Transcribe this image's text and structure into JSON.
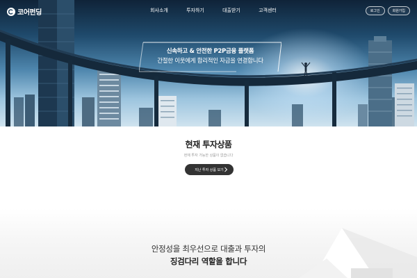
{
  "header": {
    "logo_text": "코어펀딩",
    "nav": [
      "회사소개",
      "투자하기",
      "대출받기",
      "고객센터"
    ],
    "login_label": "로그인",
    "signup_label": "회원가입"
  },
  "hero": {
    "headline_line1": "신속하고 & 안전한 P2P금융 플랫폼",
    "headline_line2": "간절한 이웃에게 합리적인 자금을 연결합니다"
  },
  "products": {
    "title": "현재 투자상품",
    "subtitle": "현재 투자 가능한 상품이 없습니다",
    "past_button_label": "지난 투자 상품 보기"
  },
  "bottom": {
    "line1": "안정성을 최우선으로 대출과 투자의",
    "line2": "징검다리 역할을 합니다"
  },
  "colors": {
    "button_dark": "#333333",
    "sky_top": "#0f2338",
    "sky_bottom": "#cfe3ef"
  }
}
